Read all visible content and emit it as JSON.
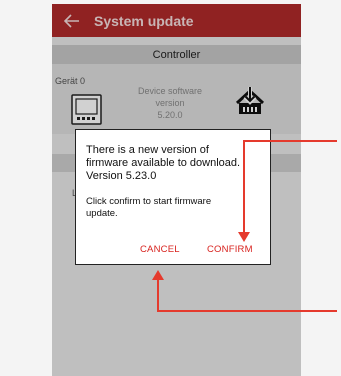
{
  "appbar": {
    "title": "System update",
    "back_icon": "arrow-left-icon"
  },
  "section": {
    "title": "Controller"
  },
  "device": {
    "name": "Gerät 0",
    "software_label_line1": "Device software",
    "software_label_line2": "version",
    "software_version": "5.20.0",
    "device_icon": "controller-device-icon",
    "download_icon": "firmware-download-icon"
  },
  "list": {
    "partial_letter": "L"
  },
  "dialog": {
    "message_line1": "There is a new version of",
    "message_line2": "firmware available to download.",
    "message_line3": "Version 5.23.0",
    "instruction_line1": "Click confirm to start firmware",
    "instruction_line2": "update.",
    "cancel_label": "CANCEL",
    "confirm_label": "CONFIRM"
  },
  "colors": {
    "appbar": "#b02a2a",
    "accent": "#d8231f",
    "annotation_arrow": "#e53a2d"
  }
}
